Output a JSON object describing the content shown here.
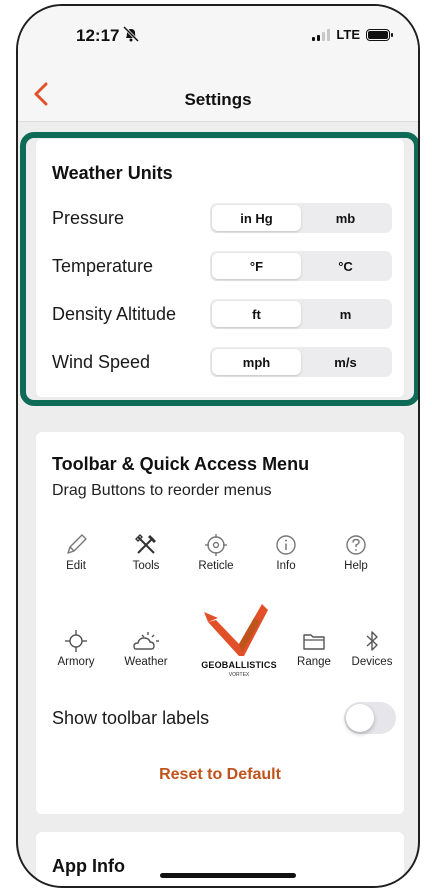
{
  "status": {
    "time": "12:17",
    "network": "LTE"
  },
  "nav": {
    "title": "Settings"
  },
  "weather_units": {
    "title": "Weather Units",
    "rows": [
      {
        "label": "Pressure",
        "options": [
          "in Hg",
          "mb"
        ],
        "selected": "in Hg"
      },
      {
        "label": "Temperature",
        "options": [
          "°F",
          "°C"
        ],
        "selected": "°F"
      },
      {
        "label": "Density Altitude",
        "options": [
          "ft",
          "m"
        ],
        "selected": "ft"
      },
      {
        "label": "Wind Speed",
        "options": [
          "mph",
          "m/s"
        ],
        "selected": "mph"
      }
    ]
  },
  "toolbar": {
    "title": "Toolbar & Quick Access Menu",
    "subtitle": "Drag Buttons to reorder menus",
    "top_items": [
      {
        "label": "Edit",
        "icon": "pencil-icon"
      },
      {
        "label": "Tools",
        "icon": "tools-icon"
      },
      {
        "label": "Reticle",
        "icon": "reticle-icon"
      },
      {
        "label": "Info",
        "icon": "info-icon"
      },
      {
        "label": "Help",
        "icon": "help-icon"
      }
    ],
    "bottom_items": [
      {
        "label": "Armory",
        "icon": "armory-icon"
      },
      {
        "label": "Weather",
        "icon": "weather-icon"
      },
      {
        "label": "Range",
        "icon": "folder-icon"
      },
      {
        "label": "Devices",
        "icon": "bluetooth-icon"
      }
    ],
    "logo_text": "GEOBALLISTICS",
    "logo_subtext": "VORTEX",
    "toggle_label": "Show toolbar labels",
    "toggle_on": false,
    "reset_label": "Reset to Default"
  },
  "app_info": {
    "title": "App Info"
  },
  "colors": {
    "accent": "#c0531c",
    "highlight": "#0d6b57",
    "logo": "#e2502a"
  }
}
